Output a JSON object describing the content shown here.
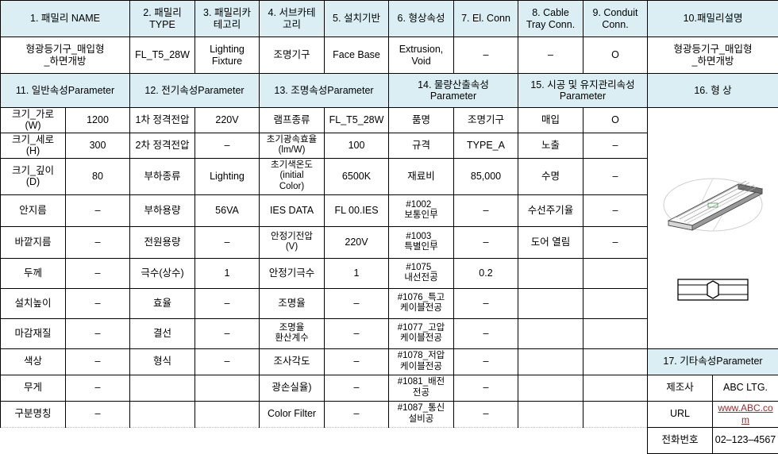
{
  "header_top": {
    "cells": [
      {
        "label": "1. 패밀리 NAME",
        "value": "형광등기구_매입형\n_하면개방"
      },
      {
        "label": "2. 패밀리\nTYPE",
        "value": "FL_T5_28W"
      },
      {
        "label": "3. 패밀리카\n테고리",
        "value": "Lighting\nFixture"
      },
      {
        "label": "4. 서브카테\n고리",
        "value": "조명기구"
      },
      {
        "label": "5. 설치기반",
        "value": "Face Base"
      },
      {
        "label": "6. 형상속성",
        "value": "Extrusion,\nVoid"
      },
      {
        "label": "7. El. Conn",
        "value": "–"
      },
      {
        "label": "8. Cable\nTray Conn.",
        "value": "–"
      },
      {
        "label": "9. Conduit\nConn.",
        "value": "O"
      },
      {
        "label": "10.패밀리설명",
        "value": "형광등기구_매입형\n_하면개방"
      }
    ]
  },
  "header_mid": {
    "general": "11. 일반속성Parameter",
    "electrical": "12. 전기속성Parameter",
    "lighting": "13. 조명속성Parameter",
    "quantity": "14. 물량산출속성\nParameter",
    "construction": "15. 시공 및 유지관리속성\nParameter",
    "shape": "16. 형 상"
  },
  "general_params": [
    {
      "label": "크기_가로\n(W)",
      "value": "1200"
    },
    {
      "label": "크기_세로\n(H)",
      "value": "300"
    },
    {
      "label": "크기_깊이\n(D)",
      "value": "80"
    },
    {
      "label": "안지름",
      "value": "–"
    },
    {
      "label": "바깥지름",
      "value": "–"
    },
    {
      "label": "두께",
      "value": "–"
    },
    {
      "label": "설치높이",
      "value": "–"
    },
    {
      "label": "마감재질",
      "value": "–"
    },
    {
      "label": "색상",
      "value": "–"
    },
    {
      "label": "무게",
      "value": "–"
    },
    {
      "label": "구분명칭",
      "value": "–"
    }
  ],
  "electrical_params": [
    {
      "label": "1차 정격전압",
      "value": "220V"
    },
    {
      "label": "2차 정격전압",
      "value": "–"
    },
    {
      "label": "부하종류",
      "value": "Lighting"
    },
    {
      "label": "부하용량",
      "value": "56VA"
    },
    {
      "label": "전원용량",
      "value": "–"
    },
    {
      "label": "극수(상수)",
      "value": "1"
    },
    {
      "label": "효율",
      "value": "–"
    },
    {
      "label": "결선",
      "value": "–"
    },
    {
      "label": "형식",
      "value": "–"
    },
    {
      "label": "",
      "value": ""
    },
    {
      "label": "",
      "value": ""
    }
  ],
  "lighting_params": [
    {
      "label": "램프종류",
      "value": "FL_T5_28W"
    },
    {
      "label": "초기광속효율\n(lm/W)",
      "value": "100"
    },
    {
      "label": "초기색온도\n(initial\nColor)",
      "value": "6500K"
    },
    {
      "label": "IES DATA",
      "value": "FL 00.IES"
    },
    {
      "label": "안정기전압\n(V)",
      "value": "220V"
    },
    {
      "label": "안정기극수",
      "value": "1"
    },
    {
      "label": "조명율",
      "value": "–"
    },
    {
      "label": "조명율\n환산계수",
      "value": "–"
    },
    {
      "label": "조사각도",
      "value": "–"
    },
    {
      "label": "광손실율)",
      "value": "–"
    },
    {
      "label": "Color Filter",
      "value": "–"
    }
  ],
  "quantity_params": [
    {
      "label": "품명",
      "value": "조명기구"
    },
    {
      "label": "규격",
      "value": "TYPE_A"
    },
    {
      "label": "재료비",
      "value": "85,000"
    },
    {
      "label": "#1002_\n보통인부",
      "value": "–"
    },
    {
      "label": "#1003_\n특별인부",
      "value": "–"
    },
    {
      "label": "#1075_\n내선전공",
      "value": "0.2"
    },
    {
      "label": "#1076_특고\n케이블전공",
      "value": "–"
    },
    {
      "label": "#1077_고압\n케이블전공",
      "value": "–"
    },
    {
      "label": "#1078_저압\n케이블전공",
      "value": "–"
    },
    {
      "label": "#1081_배전\n전공",
      "value": "–"
    },
    {
      "label": "#1087_통신\n설비공",
      "value": "–"
    }
  ],
  "construction_params": [
    {
      "label": "매입",
      "value": "O"
    },
    {
      "label": "노출",
      "value": "–"
    },
    {
      "label": "수명",
      "value": "–"
    },
    {
      "label": "수선주기율",
      "value": "–"
    },
    {
      "label": "도어 열림",
      "value": "–"
    },
    {
      "label": "",
      "value": ""
    },
    {
      "label": "",
      "value": ""
    },
    {
      "label": "",
      "value": ""
    },
    {
      "label": "",
      "value": ""
    },
    {
      "label": "",
      "value": ""
    },
    {
      "label": "",
      "value": ""
    }
  ],
  "shape": {
    "render_name": "3d-lighting-fixture-render",
    "symbol_name": "2d-lighting-fixture-symbol"
  },
  "other_params": {
    "title": "17. 기타속성Parameter",
    "rows": [
      {
        "label": "제조사",
        "value": "ABC  LTG."
      },
      {
        "label": "URL",
        "value": "www.ABC.com"
      },
      {
        "label": "전화번호",
        "value": "02–123–4567"
      }
    ]
  },
  "colors": {
    "header_bg": "#daeef3",
    "border": "#000000",
    "link": "#9b2d2d"
  }
}
